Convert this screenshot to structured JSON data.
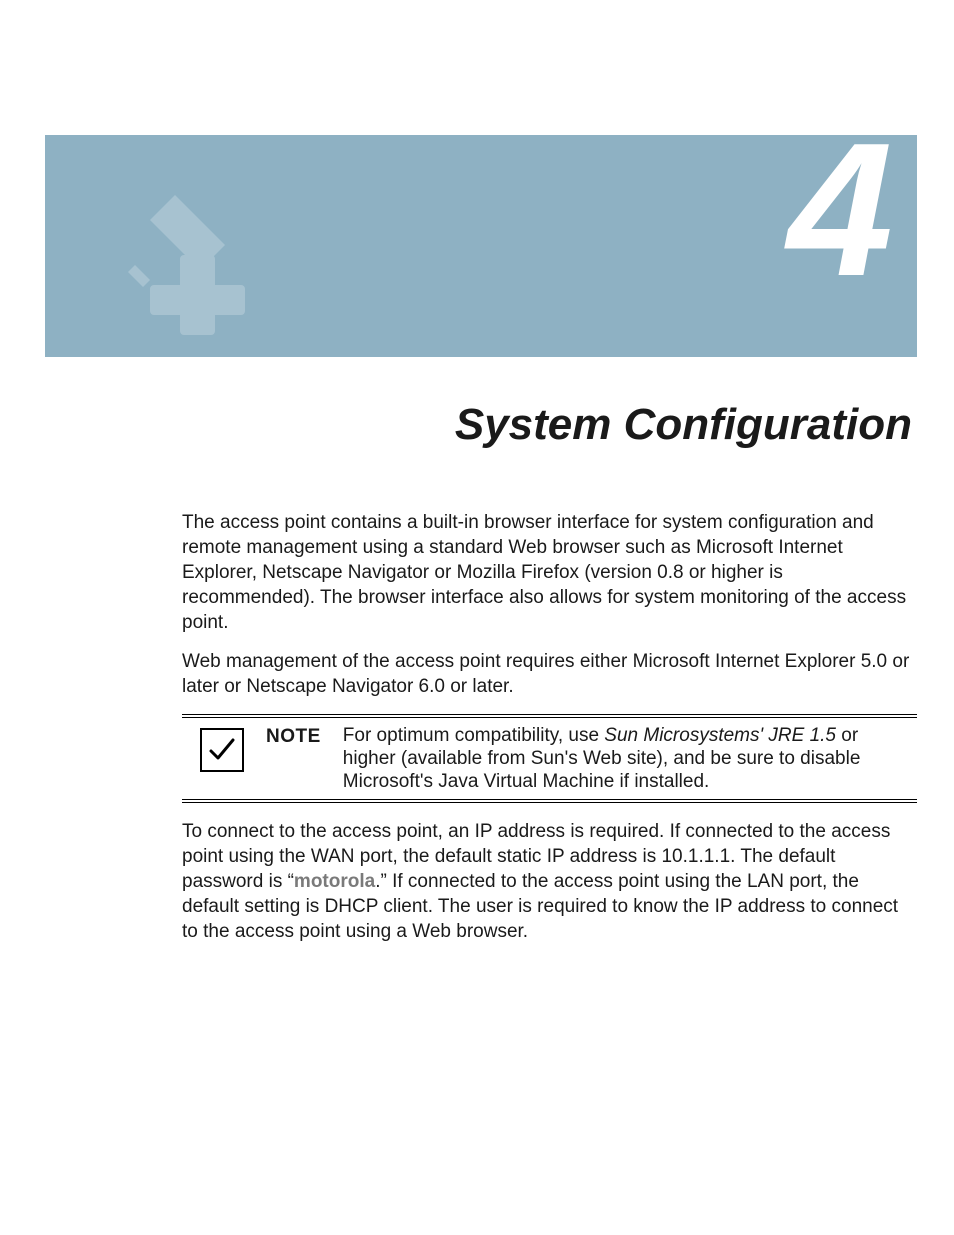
{
  "chapter": {
    "number": "4",
    "title": "System Configuration"
  },
  "paragraphs": {
    "p1": "The access point contains a built-in browser interface for system configuration and remote management using a standard Web browser such as Microsoft Internet Explorer, Netscape Navigator or Mozilla Firefox (version 0.8 or higher is recommended). The browser interface also allows for system monitoring of the access point.",
    "p2": "Web management of the access point requires either Microsoft Internet Explorer 5.0 or later or Netscape Navigator 6.0 or later.",
    "p3_a": "To connect to the access point, an IP address is required. If connected to the access point using the WAN port, the default static IP address is 10.1.1.1. The default password is “",
    "p3_bold": "motorola",
    "p3_b": ".” If connected to the access point using the LAN port, the default setting is DHCP client. The user is required to know the IP address to connect to the access point using a Web browser."
  },
  "note": {
    "label": "NOTE",
    "body_a": "For optimum compatibility, use ",
    "body_italic": "Sun Microsystems' JRE 1.5",
    "body_b": " or higher (available from Sun's Web site), and be sure to disable Microsoft's Java Virtual Machine if installed."
  }
}
